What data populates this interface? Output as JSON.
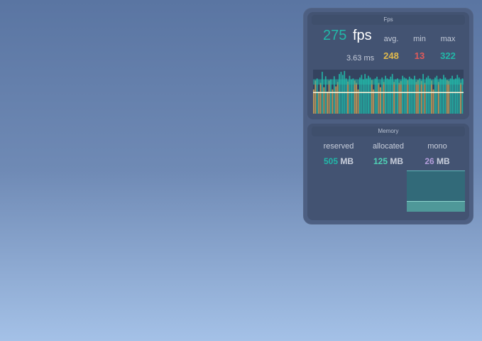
{
  "fps_panel": {
    "title": "Fps",
    "current_fps": "275",
    "fps_unit": "fps",
    "frame_time": "3.63 ms",
    "stats": [
      {
        "label": "avg.",
        "value": "248",
        "color": "#e0b94c"
      },
      {
        "label": "min",
        "value": "13",
        "color": "#e05a5a"
      },
      {
        "label": "max",
        "value": "322",
        "color": "#22b7a8"
      }
    ],
    "graph": {
      "type": "bar",
      "values": [
        0.55,
        0.75,
        0.8,
        0.5,
        0.7,
        0.95,
        0.6,
        0.85,
        0.5,
        0.75,
        0.78,
        0.55,
        0.85,
        0.62,
        0.72,
        0.9,
        0.95,
        0.88,
        0.97,
        0.8,
        0.73,
        0.86,
        0.78,
        0.8,
        0.75,
        0.7,
        0.55,
        0.82,
        0.88,
        0.78,
        0.9,
        0.8,
        0.86,
        0.82,
        0.76,
        0.55,
        0.8,
        0.84,
        0.7,
        0.6,
        0.82,
        0.72,
        0.86,
        0.8,
        0.78,
        0.84,
        0.9,
        0.72,
        0.78,
        0.8,
        0.7,
        0.74,
        0.86,
        0.82,
        0.8,
        0.76,
        0.84,
        0.8,
        0.78,
        0.86,
        0.72,
        0.76,
        0.8,
        0.74,
        0.9,
        0.7,
        0.82,
        0.86,
        0.8,
        0.75,
        0.55,
        0.82,
        0.86,
        0.72,
        0.8,
        0.78,
        0.88,
        0.82,
        0.76,
        0.74,
        0.8,
        0.86,
        0.78,
        0.8,
        0.88,
        0.82,
        0.7,
        0.8
      ],
      "avg_level": 0.48,
      "max_level": 0.78,
      "high_color": "#22b7a8",
      "low_color": "#c9a15a",
      "bg_color": "#34435f"
    }
  },
  "memory_panel": {
    "title": "Memory",
    "columns": [
      {
        "label": "reserved",
        "value": "505",
        "unit": "MB",
        "color": "#22b7a8"
      },
      {
        "label": "allocated",
        "value": "125",
        "unit": "MB",
        "color": "#4fd1b5"
      },
      {
        "label": "mono",
        "value": "26",
        "unit": "MB",
        "color": "#b39ddb"
      }
    ],
    "graph": {
      "type": "area",
      "reserved_level": 1.0,
      "allocated_level": 0.25,
      "fill_color": "#2f6f7a",
      "line_color": "#5fb3b6"
    }
  }
}
